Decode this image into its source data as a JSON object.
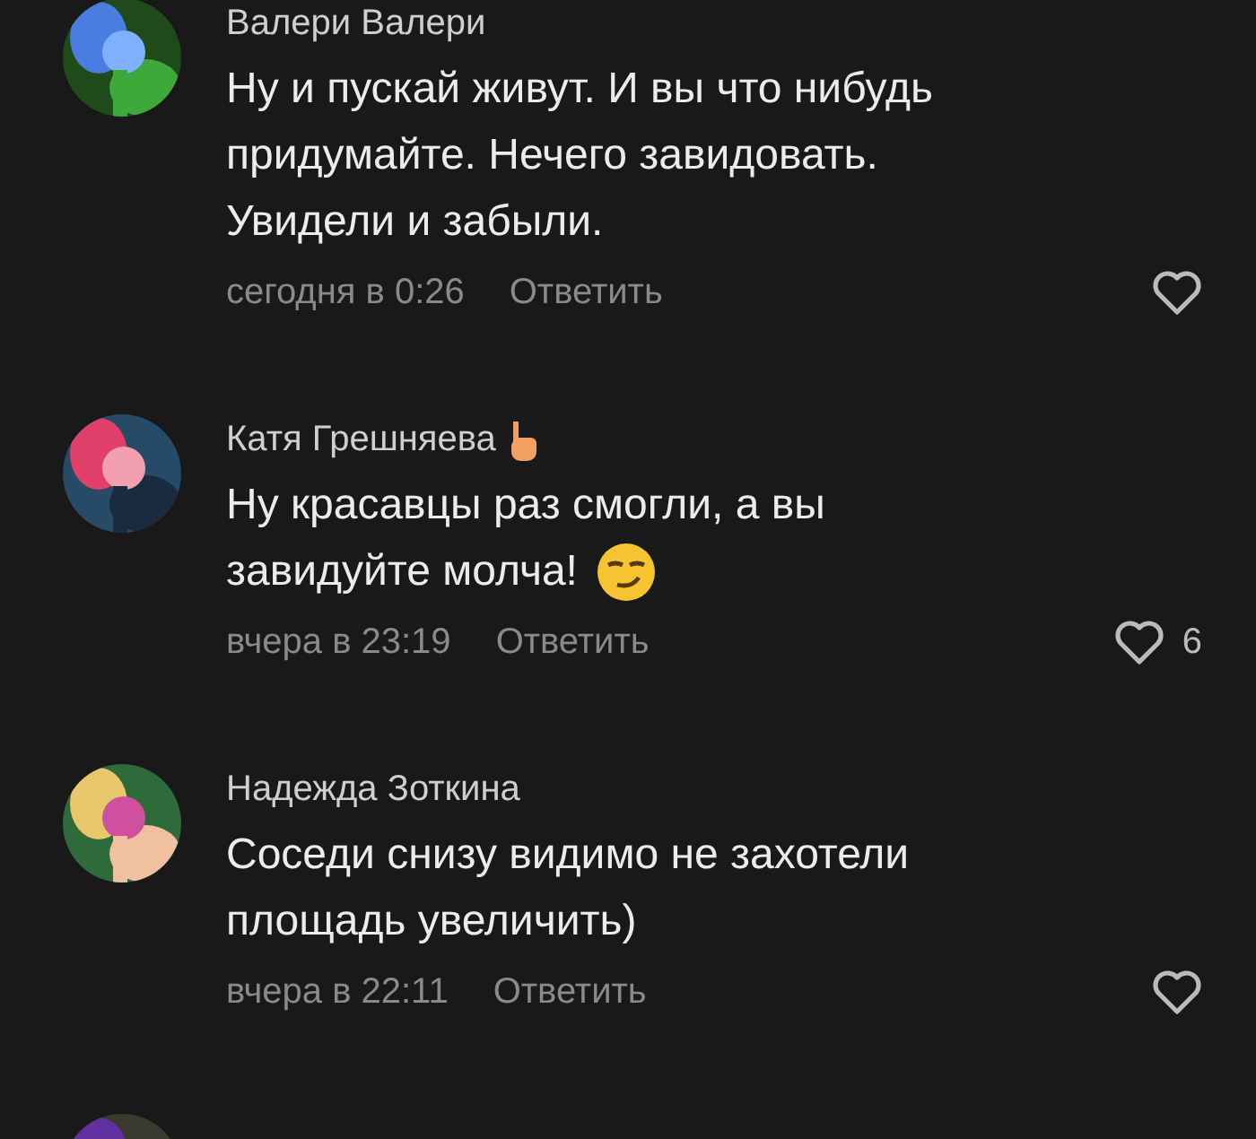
{
  "comments": [
    {
      "author": "Валери Валери",
      "avatar": {
        "kind": "picture"
      },
      "text_lines": [
        "Ну и пускай живут. И вы что нибудь",
        "придумайте. Нечего завидовать.",
        "Увидели и забыли."
      ],
      "time": "сегодня в 0:26",
      "reply": "Ответить",
      "liked": false
    },
    {
      "author": "Катя Грешняева",
      "author_emoji": true,
      "avatar": {
        "kind": "picture"
      },
      "text_lines": [
        "Ну красавцы раз смогли, а вы",
        "завидуйте молча!"
      ],
      "text_emoji": true,
      "time": "вчера в 23:19",
      "reply": "Ответить",
      "liked": false,
      "likes": "6"
    },
    {
      "author": "Надежда Зоткина",
      "avatar": {
        "kind": "picture"
      },
      "text_lines": [
        "Соседи снизу видимо не захотели",
        "площадь увеличить)"
      ],
      "time": "вчера в 22:11",
      "reply": "Ответить",
      "liked": false
    },
    {
      "avatar": {
        "kind": "picture"
      }
    }
  ]
}
